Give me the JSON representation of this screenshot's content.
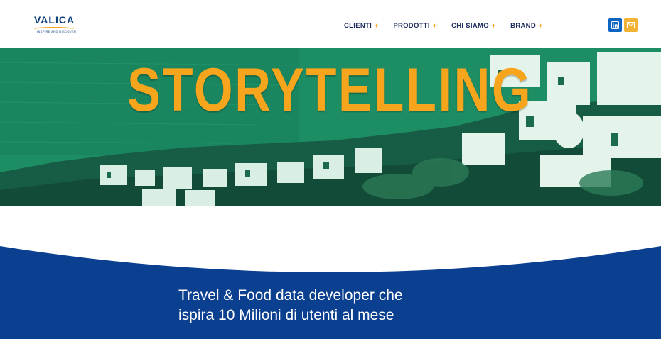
{
  "brand": {
    "name": "VALICA",
    "tagline": "INSPIRE AND DISCOVER",
    "colors": {
      "navy": "#0a3d7a",
      "orange": "#f2a51a",
      "hero_green": "#1b8a5f",
      "band_blue": "#0b3f8f"
    }
  },
  "nav": {
    "items": [
      {
        "label": "CLIENTI",
        "suffix": "+"
      },
      {
        "label": "PRODOTTI",
        "suffix": "+"
      },
      {
        "label": "CHI SIAMO",
        "suffix": "+"
      },
      {
        "label": "BRAND",
        "suffix": "+"
      }
    ]
  },
  "social": {
    "linkedin_icon": "linkedin-icon",
    "mail_icon": "mail-icon"
  },
  "hero": {
    "title": "STORYTELLING"
  },
  "banner": {
    "line1": "Travel & Food data developer che",
    "line2": "ispira 10 Milioni di utenti al mese"
  }
}
